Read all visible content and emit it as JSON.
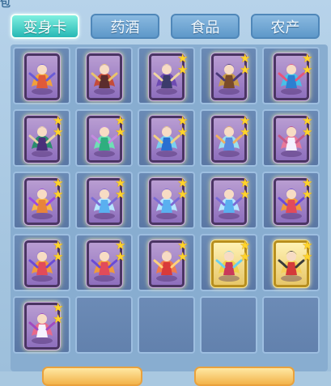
{
  "window": {
    "title_fragment": "包"
  },
  "tabs": [
    {
      "label": "变身卡",
      "active": true
    },
    {
      "label": "药酒",
      "active": false
    },
    {
      "label": "食品",
      "active": false
    },
    {
      "label": "农产",
      "active": false
    }
  ],
  "inventory": {
    "columns": 5,
    "rows": 5,
    "items": [
      {
        "icon": "transformation-card-bird-icon",
        "stars": 0,
        "frame": "purple"
      },
      {
        "icon": "transformation-card-warrior-icon",
        "stars": 0,
        "frame": "purple"
      },
      {
        "icon": "transformation-card-horse-rider-icon",
        "stars": 2,
        "frame": "purple"
      },
      {
        "icon": "transformation-card-armored-warrior-icon",
        "stars": 2,
        "frame": "purple"
      },
      {
        "icon": "transformation-card-blue-mage-icon",
        "stars": 2,
        "frame": "purple"
      },
      {
        "icon": "transformation-card-cloaked-figure-icon",
        "stars": 2,
        "frame": "purple"
      },
      {
        "icon": "transformation-card-green-dancer-icon",
        "stars": 2,
        "frame": "purple"
      },
      {
        "icon": "transformation-card-blue-warrior-icon",
        "stars": 2,
        "frame": "purple"
      },
      {
        "icon": "transformation-card-fairy-icon",
        "stars": 2,
        "frame": "purple"
      },
      {
        "icon": "transformation-card-rabbit-girl-icon",
        "stars": 2,
        "frame": "purple"
      },
      {
        "icon": "transformation-card-fox-icon",
        "stars": 2,
        "frame": "purple"
      },
      {
        "icon": "transformation-card-ice-spirit-icon",
        "stars": 2,
        "frame": "purple"
      },
      {
        "icon": "transformation-card-ice-spirit-icon",
        "stars": 2,
        "frame": "purple"
      },
      {
        "icon": "transformation-card-ice-spirit-icon",
        "stars": 2,
        "frame": "purple"
      },
      {
        "icon": "transformation-card-phoenix-icon",
        "stars": 2,
        "frame": "purple"
      },
      {
        "icon": "transformation-card-phoenix-icon",
        "stars": 2,
        "frame": "purple"
      },
      {
        "icon": "transformation-card-phoenix-icon",
        "stars": 2,
        "frame": "purple"
      },
      {
        "icon": "transformation-card-red-hero-icon",
        "stars": 2,
        "frame": "purple"
      },
      {
        "icon": "transformation-card-golden-hero-icon",
        "stars": 2,
        "frame": "gold"
      },
      {
        "icon": "transformation-card-golden-heroine-icon",
        "stars": 2,
        "frame": "gold"
      },
      {
        "icon": "transformation-card-white-dancer-icon",
        "stars": 2,
        "frame": "purple"
      },
      {
        "icon": "empty-slot",
        "stars": 0,
        "frame": "none"
      },
      {
        "icon": "empty-slot",
        "stars": 0,
        "frame": "none"
      },
      {
        "icon": "empty-slot",
        "stars": 0,
        "frame": "none"
      },
      {
        "icon": "empty-slot",
        "stars": 0,
        "frame": "none"
      }
    ]
  }
}
